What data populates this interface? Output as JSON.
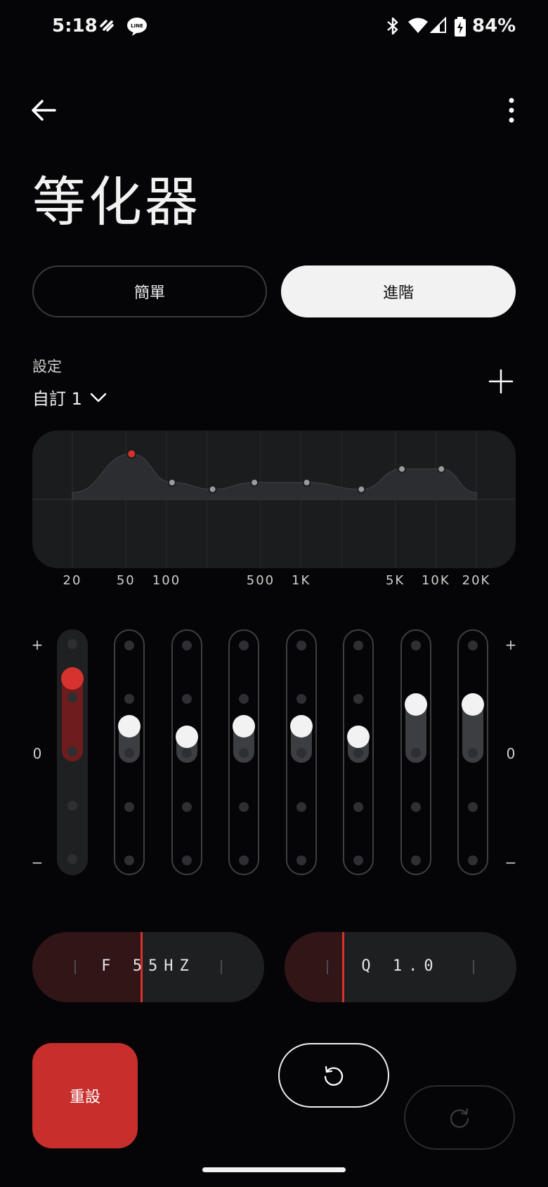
{
  "status_bar": {
    "time": "5:18",
    "battery": "84%",
    "icons": [
      "app-notification-icon",
      "line-app-icon",
      "bluetooth-icon",
      "wifi-icon",
      "cell-signal-icon",
      "battery-charging-icon"
    ]
  },
  "header": {
    "title": "等化器"
  },
  "mode_toggle": {
    "simple_label": "簡單",
    "advanced_label": "進階",
    "selected": "進階"
  },
  "settings": {
    "label": "設定",
    "preset_value": "自訂 1"
  },
  "chart_data": {
    "type": "line",
    "x_scale": "log",
    "tick_labels": [
      "20",
      "50",
      "100",
      "500",
      "1K",
      "5K",
      "10K",
      "20K"
    ],
    "points": [
      {
        "freq": 55,
        "gain": 2.7,
        "selected": true
      },
      {
        "freq": 110,
        "gain": 1.0
      },
      {
        "freq": 220,
        "gain": 0.6
      },
      {
        "freq": 450,
        "gain": 1.0
      },
      {
        "freq": 1100,
        "gain": 1.0
      },
      {
        "freq": 2800,
        "gain": 0.6
      },
      {
        "freq": 5600,
        "gain": 1.8
      },
      {
        "freq": 11000,
        "gain": 1.8
      }
    ]
  },
  "sliders": {
    "scale": {
      "plus": "+",
      "zero": "0",
      "minus": "−"
    },
    "bands": [
      {
        "gain": 2.7,
        "active": true
      },
      {
        "gain": 1.0
      },
      {
        "gain": 0.6
      },
      {
        "gain": 1.0
      },
      {
        "gain": 1.0
      },
      {
        "gain": 0.6
      },
      {
        "gain": 1.8
      },
      {
        "gain": 1.8
      }
    ]
  },
  "frequency_control": {
    "label": "F 55HZ",
    "position": 0.47
  },
  "q_control": {
    "label": "Q 1.0",
    "position": 0.25
  },
  "actions": {
    "reset_label": "重設",
    "undo_icon": "undo-icon",
    "redo_icon": "redo-icon"
  },
  "colors": {
    "accent": "#d6322e",
    "background": "#050507",
    "reset": "#c72f2d"
  }
}
